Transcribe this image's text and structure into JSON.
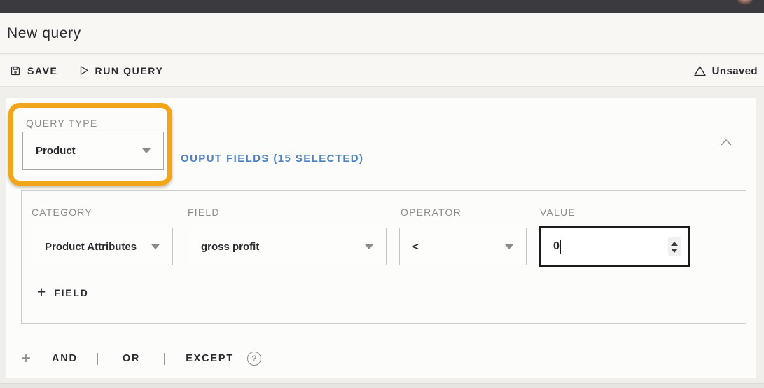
{
  "header": {
    "title": "New query"
  },
  "toolbar": {
    "save": "SAVE",
    "run_query": "RUN QUERY",
    "status": "Unsaved"
  },
  "builder": {
    "query_type": {
      "label": "QUERY TYPE",
      "value": "Product"
    },
    "output_fields": "OUPUT FIELDS (15 SELECTED)",
    "filter_row": {
      "category": {
        "label": "CATEGORY",
        "value": "Product Attributes"
      },
      "field": {
        "label": "FIELD",
        "value": "gross profit"
      },
      "operator": {
        "label": "OPERATOR",
        "value": "<"
      },
      "value": {
        "label": "VALUE",
        "value": "0"
      },
      "add_field": "FIELD"
    },
    "logic": {
      "and": "AND",
      "or": "OR",
      "except": "EXCEPT",
      "help": "?"
    }
  },
  "colors": {
    "topbar_bg": "#3B3A3F",
    "highlight_orange": "#F0A616",
    "link_blue": "#4D82BE",
    "focused_border": "#1B1B1B",
    "label_gray": "#8C8B89",
    "text_dark": "#2B2A2E"
  }
}
